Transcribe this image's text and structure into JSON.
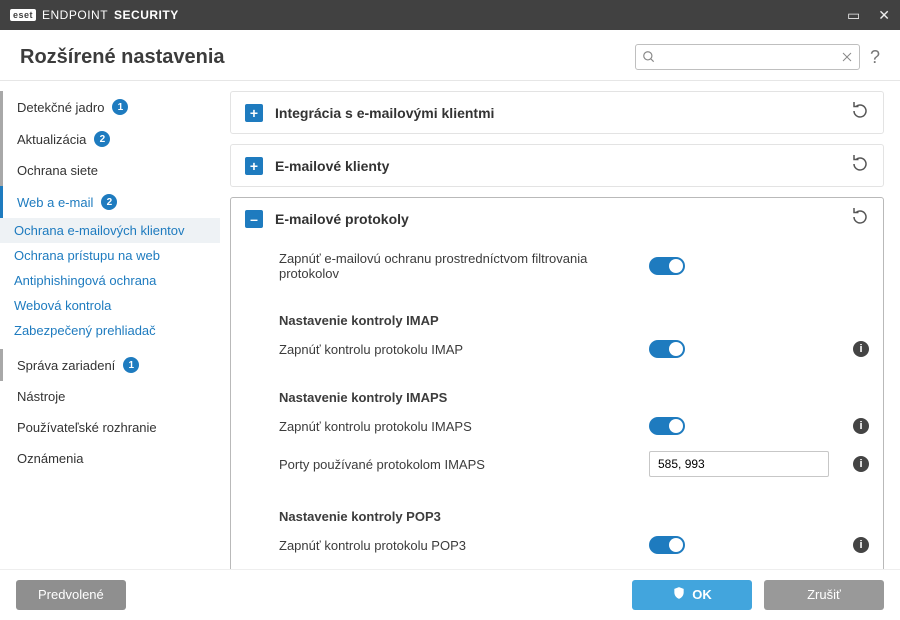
{
  "titlebar": {
    "brand_badge": "eset",
    "brand_thin": "ENDPOINT",
    "brand_bold": "SECURITY"
  },
  "header": {
    "title": "Rozšírené nastavenia",
    "search_placeholder": "",
    "help": "?"
  },
  "sidebar": {
    "items": [
      {
        "label": "Detekčné jadro",
        "badge": "1"
      },
      {
        "label": "Aktualizácia",
        "badge": "2"
      },
      {
        "label": "Ochrana siete"
      },
      {
        "label": "Web a e-mail",
        "badge": "2",
        "active": true,
        "children": [
          {
            "label": "Ochrana e-mailových klientov",
            "selected": true
          },
          {
            "label": "Ochrana prístupu na web"
          },
          {
            "label": "Antiphishingová ochrana"
          },
          {
            "label": "Webová kontrola"
          },
          {
            "label": "Zabezpečený prehliadač"
          }
        ]
      },
      {
        "label": "Správa zariadení",
        "badge": "1"
      },
      {
        "label": "Nástroje"
      },
      {
        "label": "Používateľské rozhranie"
      },
      {
        "label": "Oznámenia"
      }
    ]
  },
  "panels": {
    "integration": {
      "title": "Integrácia s e-mailovými klientmi"
    },
    "clients": {
      "title": "E-mailové klienty"
    },
    "protocols": {
      "title": "E-mailové protokoly",
      "enable_filtering": "Zapnúť e-mailovú ochranu prostredníctvom filtrovania protokolov",
      "imap_heading": "Nastavenie kontroly IMAP",
      "imap_enable": "Zapnúť kontrolu protokolu IMAP",
      "imaps_heading": "Nastavenie kontroly IMAPS",
      "imaps_enable": "Zapnúť kontrolu protokolu IMAPS",
      "imaps_ports_label": "Porty používané protokolom IMAPS",
      "imaps_ports_value": "585, 993",
      "pop3_heading": "Nastavenie kontroly POP3",
      "pop3_enable": "Zapnúť kontrolu protokolu POP3"
    }
  },
  "footer": {
    "defaults": "Predvolené",
    "ok": "OK",
    "cancel": "Zrušiť"
  }
}
